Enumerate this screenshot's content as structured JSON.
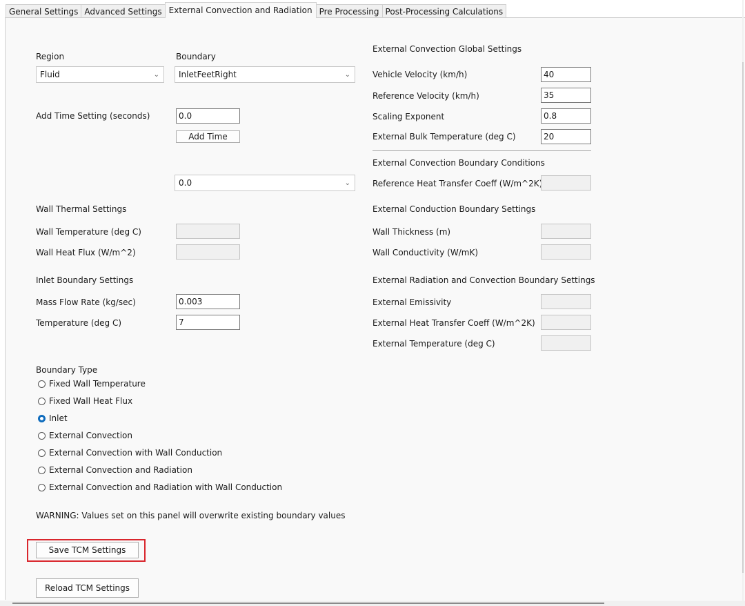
{
  "tabs": [
    {
      "label": "General Settings",
      "active": false
    },
    {
      "label": "Advanced Settings",
      "active": false
    },
    {
      "label": "External Convection and Radiation",
      "active": true
    },
    {
      "label": "Pre Processing",
      "active": false
    },
    {
      "label": "Post-Processing Calculations",
      "active": false
    }
  ],
  "region": {
    "label": "Region",
    "value": "Fluid"
  },
  "boundary": {
    "label": "Boundary",
    "value": "InletFeetRight"
  },
  "add_time": {
    "label": "Add Time Setting (seconds)",
    "value": "0.0",
    "button": "Add Time"
  },
  "time_select": {
    "value": "0.0"
  },
  "wall_thermal": {
    "heading": "Wall Thermal Settings",
    "temperature_label": "Wall Temperature (deg C)",
    "temperature_value": "",
    "heat_flux_label": "Wall Heat Flux (W/m^2)",
    "heat_flux_value": ""
  },
  "inlet": {
    "heading": "Inlet Boundary Settings",
    "mass_flow_label": "Mass Flow Rate (kg/sec)",
    "mass_flow_value": "0.003",
    "temperature_label": "Temperature (deg C)",
    "temperature_value": "7"
  },
  "boundary_type": {
    "heading": "Boundary Type",
    "options": [
      {
        "label": "Fixed Wall Temperature",
        "checked": false
      },
      {
        "label": "Fixed Wall Heat Flux",
        "checked": false
      },
      {
        "label": "Inlet",
        "checked": true
      },
      {
        "label": "External Convection",
        "checked": false
      },
      {
        "label": "External Convection with Wall Conduction",
        "checked": false
      },
      {
        "label": "External Convection and Radiation",
        "checked": false
      },
      {
        "label": "External Convection and Radiation with Wall Conduction",
        "checked": false
      }
    ]
  },
  "warning": "WARNING: Values set on this panel will overwrite existing boundary values",
  "save_button": "Save TCM Settings",
  "reload_button": "Reload TCM Settings",
  "global": {
    "heading": "External Convection Global Settings",
    "fields": [
      {
        "label": "Vehicle Velocity (km/h)",
        "value": "40"
      },
      {
        "label": "Reference Velocity (km/h)",
        "value": "35"
      },
      {
        "label": "Scaling Exponent",
        "value": "0.8"
      },
      {
        "label": "External Bulk Temperature (deg C)",
        "value": "20"
      }
    ]
  },
  "conv_bc": {
    "heading": "External Convection Boundary Conditions",
    "ref_htc_label": "Reference Heat Transfer Coeff (W/m^2K)",
    "ref_htc_value": ""
  },
  "conduction": {
    "heading": "External Conduction Boundary Settings",
    "thickness_label": "Wall Thickness (m)",
    "thickness_value": "",
    "conductivity_label": "Wall Conductivity (W/mK)",
    "conductivity_value": ""
  },
  "radiation": {
    "heading": "External Radiation and Convection Boundary Settings",
    "emissivity_label": "External Emissivity",
    "emissivity_value": "",
    "htc_label": "External Heat Transfer Coeff (W/m^2K)",
    "htc_value": "",
    "temperature_label": "External Temperature (deg C)",
    "temperature_value": ""
  },
  "colors": {
    "accent": "#0f6cbd",
    "highlight": "#d9262d"
  }
}
